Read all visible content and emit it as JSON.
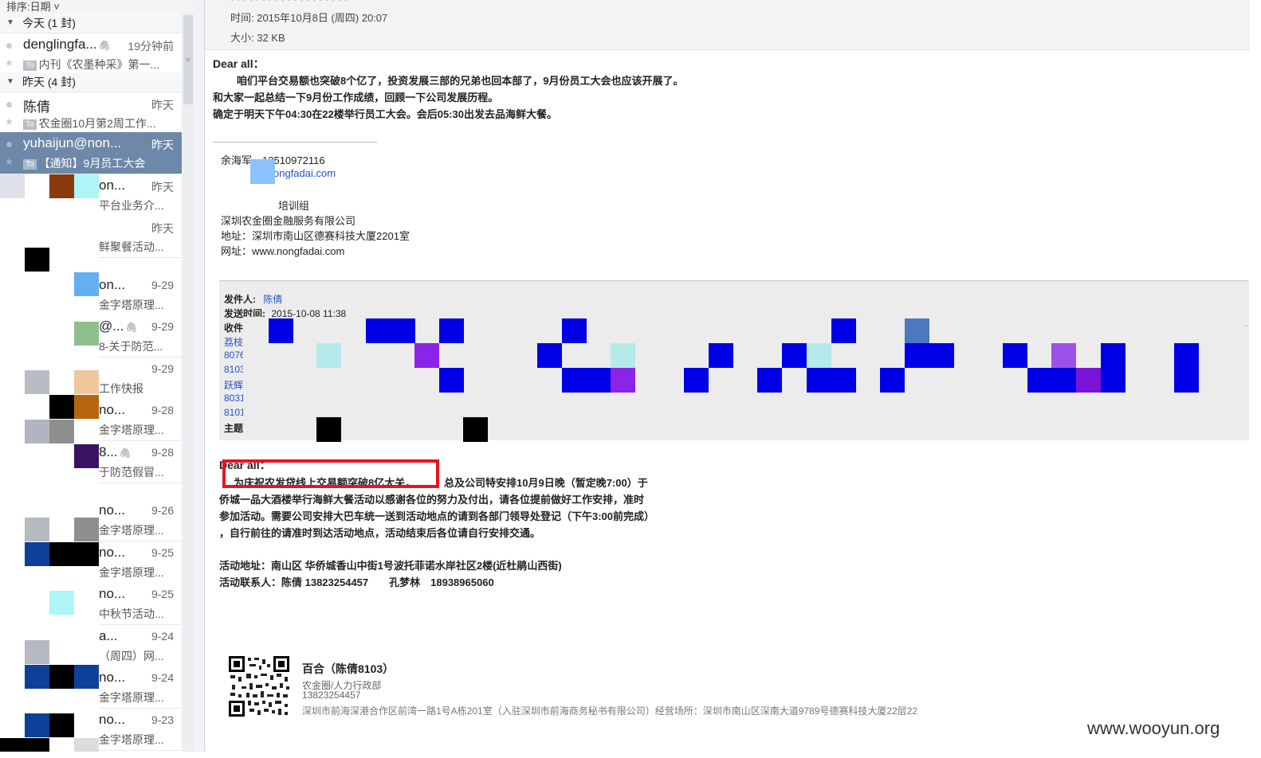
{
  "list": {
    "sort_label": "排序:日期 ˅",
    "groups": [
      {
        "label": "今天 (1 封)"
      },
      {
        "label": "昨天 (4 封)"
      }
    ],
    "items": [
      {
        "from": "denglingfa...",
        "date": "19分钟前",
        "subject": "内刊《农墨种采》第一...",
        "to": "To",
        "attachment": true
      },
      {
        "from": "陈倩",
        "date": "昨天",
        "subject": "农金圈10月第2周工作...",
        "to": "To"
      },
      {
        "from": "yuhaijun@non...",
        "date": "昨天",
        "subject": "【通知】9月员工大会",
        "to": "To",
        "selected": true
      },
      {
        "from": "on...",
        "date": "昨天",
        "subject": "平台业务介..."
      },
      {
        "from": "",
        "date": "昨天",
        "subject": "鲜聚餐活动..."
      },
      {
        "from": "on...",
        "date": "9-29",
        "subject": "金字塔原理..."
      },
      {
        "from": "@...",
        "date": "9-29",
        "subject": "8-关于防范...",
        "attachment": true
      },
      {
        "from": "",
        "date": "9-29",
        "subject": "工作快报"
      },
      {
        "from": "no...",
        "date": "9-28",
        "subject": "金字塔原理..."
      },
      {
        "from": "8...",
        "date": "9-28",
        "subject": "于防范假冒...",
        "attachment": true
      },
      {
        "from": "no...",
        "date": "9-26",
        "subject": "金字塔原理..."
      },
      {
        "from": "no...",
        "date": "9-25",
        "subject": "金字塔原理..."
      },
      {
        "from": "no...",
        "date": "9-25",
        "subject": "中秋节活动..."
      },
      {
        "from": "a...",
        "date": "9-24",
        "subject": "（周四）网..."
      },
      {
        "from": "no...",
        "date": "9-24",
        "subject": "金字塔原理..."
      },
      {
        "from": "no...",
        "date": "9-23",
        "subject": "金字塔原理..."
      }
    ]
  },
  "header": {
    "time_label": "时间: 2015年10月8日 (周四) 20:07",
    "size_label": "大小: 32 KB"
  },
  "body": {
    "greeting": "Dear all：",
    "p1": "咱们平台交易额也突破8个亿了，投资发展三部的兄弟也回本部了，9月份员工大会也应该开展了。",
    "p2": "和大家一起总结一下9月份工作成绩，回顾一下公司发展历程。",
    "p3": "确定于明天下午04:30在22楼举行员工大会。会后05:30出发去品海鲜大餐。"
  },
  "sig1": {
    "name_phone": "余海军　13510972116",
    "email": "ongfadai.com",
    "dept": "培训组",
    "company": "深圳农金圈金融服务有限公司",
    "address": "地址：深圳市南山区德赛科技大厦2201室",
    "website": "网址：www.nongfadai.com"
  },
  "quoted": {
    "sender_label": "发件人:",
    "sender": "陈倩",
    "sent_label": "发送时间:",
    "sent": "2015-10-08 11:38",
    "to_label": "收件",
    "recipients": [
      "荔枝",
      "8076",
      "8103",
      "跃辉",
      "8031",
      "8101"
    ],
    "subject_label": "主题"
  },
  "quoted_body": {
    "greeting": "Dear all：",
    "line1a": "为庆祝农发贷线上交易额突破8亿大关，",
    "line1b": "总及公司特安排10月9日晚（暂定晚7:00）于",
    "line2": "侨城一品大酒楼举行海鲜大餐活动以感谢各位的努力及付出，请各位提前做好工作安排，准时",
    "line3": "参加活动。需要公司安排大巴车统一送到活动地点的请到各部门领导处登记（下午3:00前完成）",
    "line4": "，自行前往的请准时到达活动地点，活动结束后各位请自行安排交通。",
    "addr": "活动地址：南山区 华侨城香山中街1号波托菲诺水岸社区2楼(近杜鹃山西街)",
    "contact": "活动联系人：陈倩 13823254457　　孔梦林　18938965060"
  },
  "sig2": {
    "name": "百合（陈倩8103）",
    "dept": "农金圈/人力行政部",
    "phone": "13823254457",
    "addr": "深圳市前海深港合作区前湾一路1号A栋201室（入驻深圳市前海商务秘书有限公司）经营场所：深圳市南山区深南大道9789号德赛科技大厦22层22"
  },
  "watermark": "www.wooyun.org"
}
